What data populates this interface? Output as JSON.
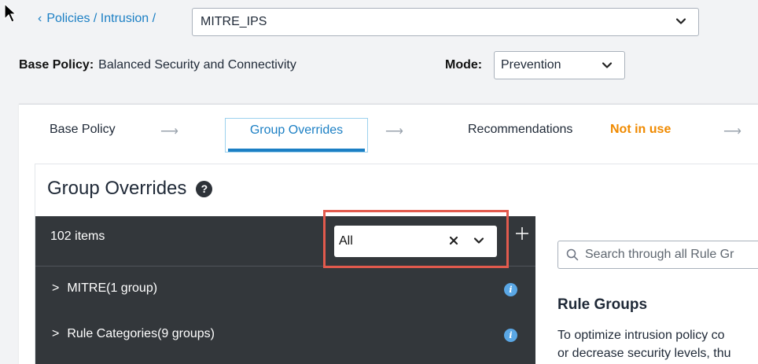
{
  "breadcrumb": {
    "prefix": "Policies / Intrusion /",
    "current": "MITRE_IPS"
  },
  "base_policy": {
    "label": "Base Policy:",
    "value": "Balanced Security and Connectivity"
  },
  "mode": {
    "label": "Mode:",
    "value": "Prevention"
  },
  "steps": {
    "base": "Base Policy",
    "group_overrides": "Group Overrides",
    "recommendations": "Recommendations",
    "recommendations_status": "Not in use",
    "arrow": "⟶"
  },
  "panel": {
    "title": "Group Overrides",
    "help": "?",
    "item_count": "102 items",
    "filter_value": "All",
    "rows": [
      {
        "label": "MITRE(1 group)"
      },
      {
        "label": "Rule Categories(9 groups)"
      }
    ]
  },
  "search": {
    "placeholder": "Search through all Rule Gr"
  },
  "rule_groups": {
    "title": "Rule Groups",
    "desc_line1": "To optimize intrusion policy co",
    "desc_line2": "or decrease security levels, thu"
  },
  "colors": {
    "accent": "#1b7fc4",
    "warning": "#f08a00",
    "highlight": "#e25a4d",
    "dark_panel": "#33373b"
  },
  "icons": [
    "cursor-arrow",
    "chevron-left",
    "chevron-down",
    "help-circle",
    "clear-x",
    "plus",
    "chevron-right",
    "info-circle",
    "search"
  ]
}
